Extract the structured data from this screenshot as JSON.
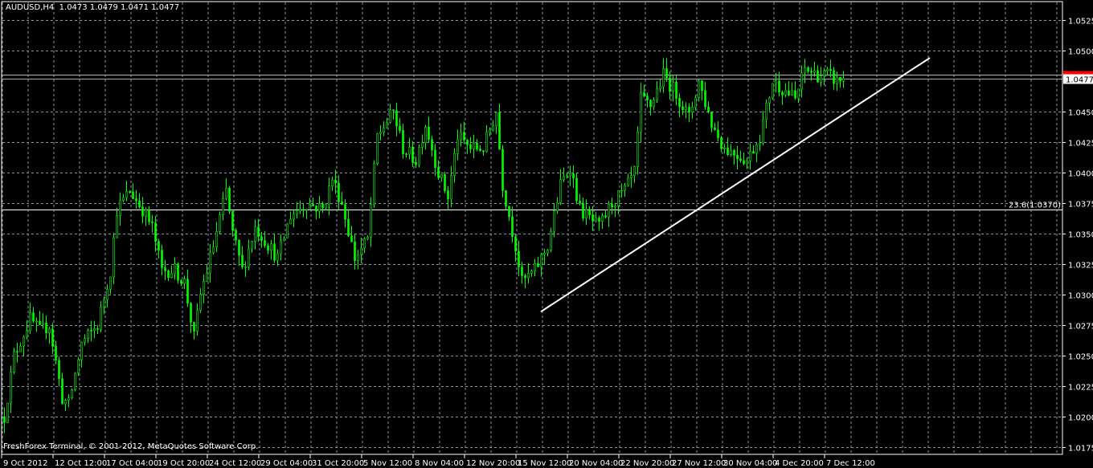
{
  "header": {
    "symbol": "AUDUSD,H4",
    "ohlc": "1.0473 1.0479 1.0471 1.0477"
  },
  "footer": {
    "copyright": "FreshForex Terminal, © 2001-2012, MetaQuotes Software Corp."
  },
  "colors": {
    "background": "#000000",
    "candle": "#00ff00",
    "grid": "#8795a8",
    "trendline": "#ffffff",
    "ask_line": "#ff0000",
    "bid_label_bg": "#ffffff"
  },
  "chart_data": {
    "type": "candlestick",
    "title": "AUDUSD,H4",
    "price_ticks": [
      "1.0525",
      "1.0500",
      "1.0450",
      "1.0425",
      "1.0400",
      "1.0375",
      "1.0350",
      "1.0325",
      "1.0300",
      "1.0275",
      "1.0250",
      "1.0225",
      "1.0200",
      "1.0175"
    ],
    "ylim": [
      1.017,
      1.054
    ],
    "time_labels": [
      "9 Oct 2012",
      "12 Oct 12:00",
      "17 Oct 04:00",
      "19 Oct 20:00",
      "24 Oct 12:00",
      "29 Oct 04:00",
      "31 Oct 20:00",
      "5 Nov 12:00",
      "8 Nov 04:00",
      "12 Nov 20:00",
      "15 Nov 12:00",
      "20 Nov 04:00",
      "22 Nov 20:00",
      "27 Nov 12:00",
      "30 Nov 04:00",
      "4 Dec 20:00",
      "7 Dec 12:00"
    ],
    "current_price": "1.0477",
    "ask_price": 1.048,
    "fibo_level": {
      "label": "23.6(1.0370)",
      "price": 1.037
    },
    "trendline": {
      "start": {
        "bar": 168,
        "price": 1.0286
      },
      "end": {
        "bar": 289,
        "price": 1.0494
      }
    },
    "close_path": [
      [
        1,
        1.02
      ],
      [
        4,
        1.025
      ],
      [
        9,
        1.028
      ],
      [
        12,
        1.027
      ],
      [
        15,
        1.0275
      ],
      [
        19,
        1.0215
      ],
      [
        21,
        1.021
      ],
      [
        25,
        1.026
      ],
      [
        30,
        1.0275
      ],
      [
        34,
        1.032
      ],
      [
        36,
        1.037
      ],
      [
        40,
        1.0385
      ],
      [
        44,
        1.037
      ],
      [
        47,
        1.0355
      ],
      [
        50,
        1.032
      ],
      [
        54,
        1.032
      ],
      [
        57,
        1.031
      ],
      [
        60,
        1.0265
      ],
      [
        62,
        1.03
      ],
      [
        66,
        1.034
      ],
      [
        70,
        1.0385
      ],
      [
        72,
        1.035
      ],
      [
        75,
        1.032
      ],
      [
        79,
        1.0355
      ],
      [
        82,
        1.0345
      ],
      [
        86,
        1.033
      ],
      [
        90,
        1.0365
      ],
      [
        95,
        1.0375
      ],
      [
        100,
        1.037
      ],
      [
        103,
        1.0395
      ],
      [
        106,
        1.0375
      ],
      [
        110,
        1.033
      ],
      [
        114,
        1.0345
      ],
      [
        117,
        1.043
      ],
      [
        122,
        1.045
      ],
      [
        125,
        1.042
      ],
      [
        129,
        1.041
      ],
      [
        132,
        1.044
      ],
      [
        136,
        1.04
      ],
      [
        139,
        1.038
      ],
      [
        142,
        1.043
      ],
      [
        146,
        1.042
      ],
      [
        150,
        1.042
      ],
      [
        154,
        1.045
      ],
      [
        156,
        1.039
      ],
      [
        160,
        1.034
      ],
      [
        162,
        1.031
      ],
      [
        166,
        1.032
      ],
      [
        170,
        1.034
      ],
      [
        174,
        1.039
      ],
      [
        177,
        1.0405
      ],
      [
        180,
        1.037
      ],
      [
        184,
        1.036
      ],
      [
        186,
        1.0355
      ],
      [
        190,
        1.0375
      ],
      [
        194,
        1.0385
      ],
      [
        197,
        1.04
      ],
      [
        199,
        1.046
      ],
      [
        202,
        1.0455
      ],
      [
        206,
        1.048
      ],
      [
        210,
        1.0465
      ],
      [
        214,
        1.0445
      ],
      [
        217,
        1.0475
      ],
      [
        221,
        1.044
      ],
      [
        225,
        1.042
      ],
      [
        229,
        1.0415
      ],
      [
        232,
        1.041
      ],
      [
        236,
        1.043
      ],
      [
        240,
        1.0475
      ],
      [
        245,
        1.0465
      ],
      [
        247,
        1.046
      ],
      [
        250,
        1.0485
      ],
      [
        254,
        1.048
      ],
      [
        257,
        1.048
      ],
      [
        260,
        1.0475
      ],
      [
        262,
        1.0477
      ]
    ]
  }
}
